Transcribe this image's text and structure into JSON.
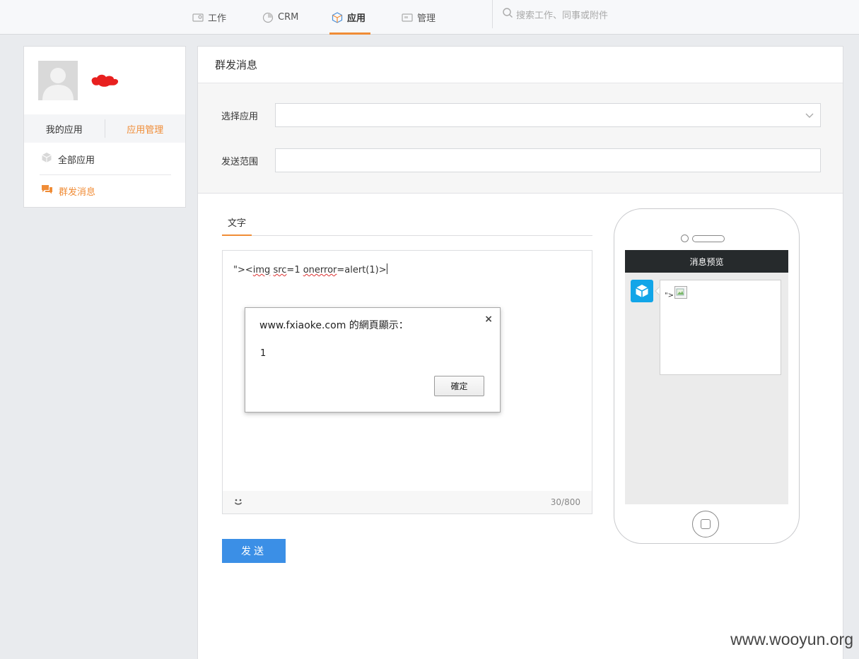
{
  "nav": {
    "items": [
      {
        "label": "工作",
        "icon": "work-icon"
      },
      {
        "label": "CRM",
        "icon": "crm-icon"
      },
      {
        "label": "应用",
        "icon": "app-cube-icon",
        "active": true
      },
      {
        "label": "管理",
        "icon": "manage-icon"
      }
    ],
    "search_placeholder": "搜索工作、同事或附件",
    "accent": "#f08c36"
  },
  "sidebar": {
    "tabs": [
      "我的应用",
      "应用管理"
    ],
    "active_tab": 1,
    "menu": [
      {
        "label": "全部应用",
        "icon": "cube-icon",
        "active": false
      },
      {
        "label": "群发消息",
        "icon": "chat-icon",
        "active": true
      }
    ]
  },
  "main": {
    "title": "群发消息",
    "select_app_label": "选择应用",
    "select_app_value": "",
    "scope_label": "发送范围",
    "scope_value": "",
    "tab": "文字",
    "editor": {
      "prefix": "\"><",
      "tag": "img",
      "space1": " ",
      "attr1": "src",
      "rest1": "=1 ",
      "attr2": "onerror",
      "rest2": "=alert(1)>"
    },
    "counter": "30/800",
    "send_label": "发送"
  },
  "preview": {
    "title": "消息预览",
    "message_text": "\">"
  },
  "dialog": {
    "title": "www.fxiaoke.com 的網頁顯示：",
    "message": "1",
    "ok_label": "確定",
    "close_glyph": "×"
  },
  "watermark": "www.wooyun.org"
}
